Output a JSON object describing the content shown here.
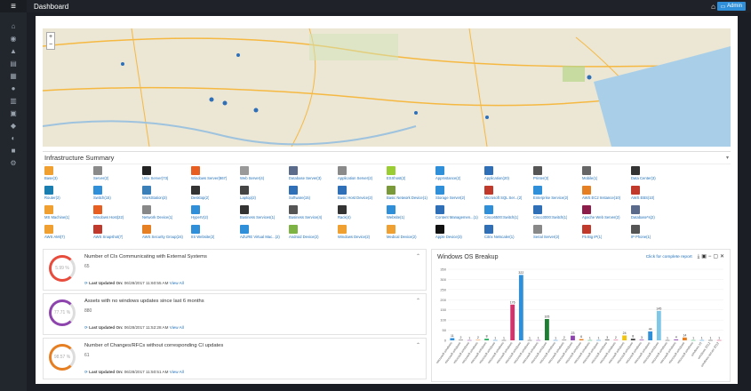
{
  "header": {
    "title": "Dashboard",
    "admin_label": "Admin"
  },
  "infra": {
    "title": "Infrastructure Summary",
    "tiles": [
      {
        "label": "Base(3)",
        "color": "#f0a030"
      },
      {
        "label": "Server(2)",
        "color": "#8a8a8a"
      },
      {
        "label": "Unix Server(73)",
        "color": "#222"
      },
      {
        "label": "Windows Server(867)",
        "color": "#e85d20"
      },
      {
        "label": "Web Server(4)",
        "color": "#999"
      },
      {
        "label": "Database Server(3)",
        "color": "#5a6a8a"
      },
      {
        "label": "Application Server(2)",
        "color": "#8a8a8a"
      },
      {
        "label": "ESXhost(2)",
        "color": "#9acd32"
      },
      {
        "label": "AppInstance(2)",
        "color": "#2f8fd8"
      },
      {
        "label": "Application(20)",
        "color": "#2f6fb8"
      },
      {
        "label": "Printer(3)",
        "color": "#555"
      },
      {
        "label": "Mobile(1)",
        "color": "#666"
      },
      {
        "label": "Data Center(3)",
        "color": "#333"
      },
      {
        "label": "",
        "color": "#fff"
      },
      {
        "label": "Router(2)",
        "color": "#1a7fb0"
      },
      {
        "label": "Switch(15)",
        "color": "#2f8fd8"
      },
      {
        "label": "WorkStation(3)",
        "color": "#3a7fb8"
      },
      {
        "label": "Desktop(2)",
        "color": "#333"
      },
      {
        "label": "Laptop(2)",
        "color": "#444"
      },
      {
        "label": "Software(15)",
        "color": "#2f6fb8"
      },
      {
        "label": "Basic Host Device(2)",
        "color": "#2f6fb8"
      },
      {
        "label": "Basic Network Device(1)",
        "color": "#7a9a3a"
      },
      {
        "label": "Storage Server(2)",
        "color": "#2f8fd8"
      },
      {
        "label": "Microsoft SQL Ser...(2)",
        "color": "#c0392b"
      },
      {
        "label": "Enterprise Service(2)",
        "color": "#2f8fd8"
      },
      {
        "label": "AWS EC2 Instance(10)",
        "color": "#e67e22"
      },
      {
        "label": "AWS EBS(10)",
        "color": "#c0392b"
      },
      {
        "label": "",
        "color": "#fff"
      },
      {
        "label": "MS Machine(1)",
        "color": "#f0a030"
      },
      {
        "label": "Windows Host(22)",
        "color": "#e85d20"
      },
      {
        "label": "Network Device(1)",
        "color": "#888"
      },
      {
        "label": "HyperV(2)",
        "color": "#2f8fd8"
      },
      {
        "label": "Business Services(1)",
        "color": "#333"
      },
      {
        "label": "Business Service(4)",
        "color": "#555"
      },
      {
        "label": "Rack(4)",
        "color": "#333"
      },
      {
        "label": "Website(1)",
        "color": "#2f8fd8"
      },
      {
        "label": "Content Managemen...(1)",
        "color": "#2f6fb8"
      },
      {
        "label": "Cisco6500:Switch(1)",
        "color": "#2f8fd8"
      },
      {
        "label": "Cisco3000:Switch(1)",
        "color": "#2f6fb8"
      },
      {
        "label": "Apache Web Server(2)",
        "color": "#8e1c4a"
      },
      {
        "label": "Database*s(2)",
        "color": "#5a6a8a"
      },
      {
        "label": "",
        "color": "#fff"
      },
      {
        "label": "AWS AMI(7)",
        "color": "#f0a030"
      },
      {
        "label": "AWS Snapshot(7)",
        "color": "#c0392b"
      },
      {
        "label": "AWS Security Group(24)",
        "color": "#e67e22"
      },
      {
        "label": "IIS Website(2)",
        "color": "#2f8fd8"
      },
      {
        "label": "AZURE Virtual Mac...(2)",
        "color": "#2f8fd8"
      },
      {
        "label": "Android Device(2)",
        "color": "#7cb342"
      },
      {
        "label": "Windows Device(2)",
        "color": "#f0a030"
      },
      {
        "label": "Medical Device(2)",
        "color": "#f0a030"
      },
      {
        "label": "Apple Device(3)",
        "color": "#111"
      },
      {
        "label": "Citrix Netscaler(1)",
        "color": "#2f6fb8"
      },
      {
        "label": "Serial Server(2)",
        "color": "#888"
      },
      {
        "label": "F5 Big IP(1)",
        "color": "#c0392b"
      },
      {
        "label": "IP Phone(1)",
        "color": "#555"
      },
      {
        "label": "",
        "color": "#fff"
      }
    ]
  },
  "cards": [
    {
      "title": "Number of CIs Communicating with External Systems",
      "pct": "5.99 %",
      "value": "65",
      "updated_label": "Last Updated On:",
      "updated": "06/28/2017 11:60:55 AM",
      "view": "View All",
      "ring_color": "#e74c3c"
    },
    {
      "title": "Assets with no windows updates since last 6 months",
      "pct": "77.71 %",
      "value": "880",
      "updated_label": "Last Updated On:",
      "updated": "06/28/2017 11:52:28 AM",
      "view": "View All",
      "ring_color": "#8e44ad"
    },
    {
      "title": "Number of Changes/RFCs without corresponding CI updates",
      "pct": "98.57 %",
      "value": "61",
      "updated_label": "Last Updated On:",
      "updated": "06/28/2017 11:50:51 AM",
      "view": "View All",
      "ring_color": "#e67e22"
    }
  ],
  "winos": {
    "title": "Windows OS Breakup",
    "report_link": "Click for complete report"
  },
  "chart_data": {
    "type": "bar",
    "ylim": [
      0,
      350
    ],
    "yticks": [
      0,
      50,
      100,
      150,
      200,
      250,
      300,
      350
    ],
    "categories": [
      "microsoft windows",
      "microsoft windows",
      "microsoft windows",
      "microsoft windows",
      "microsoft windows",
      "microsoft windows",
      "microsoft windows",
      "microsoft windows",
      "microsoft windows",
      "microsoft windows",
      "microsoft windows",
      "microsoft windows",
      "microsoft windows",
      "microsoft windows",
      "microsoft windows",
      "microsoft windows",
      "microsoft windows",
      "microsoft windows",
      "microsoft windows",
      "microsoft windows",
      "microsoft windows",
      "microsoft windows",
      "microsoft windows",
      "microsoft windows",
      "microsoft windows",
      "microsoft windows",
      "microsoft windows",
      "microsoft windows",
      "microsoft windows",
      "windows 10",
      "windows 2012",
      "windows server 2012"
    ],
    "values": [
      11,
      2,
      1,
      2,
      8,
      1,
      1,
      176,
      322,
      1,
      1,
      105,
      1,
      2,
      23,
      6,
      1,
      1,
      3,
      2,
      24,
      8,
      3,
      44,
      145,
      1,
      4,
      14,
      1,
      1,
      1,
      1
    ],
    "colors": [
      "#2f8fd8",
      "#444",
      "#8e44ad",
      "#e67e22",
      "#27ae60",
      "#2f8fd8",
      "#444",
      "#d6336c",
      "#2f8fd8",
      "#444",
      "#8e44ad",
      "#1e7e34",
      "#2f8fd8",
      "#444",
      "#8e44ad",
      "#e67e22",
      "#27ae60",
      "#2f8fd8",
      "#444",
      "#d6336c",
      "#f1c40f",
      "#444",
      "#8e44ad",
      "#2f8fd8",
      "#7fc7e6",
      "#444",
      "#8e44ad",
      "#e67e22",
      "#27ae60",
      "#2f8fd8",
      "#444",
      "#d6336c"
    ]
  }
}
